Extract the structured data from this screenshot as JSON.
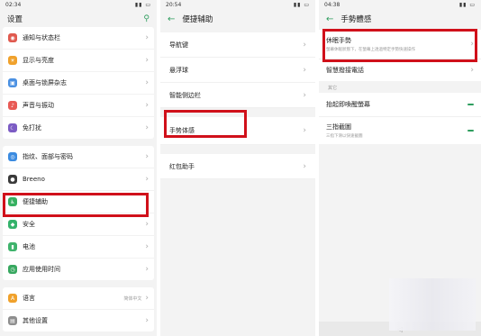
{
  "panel1": {
    "time": "02:34",
    "title": "设置",
    "items": [
      {
        "label": "通知与状态栏",
        "icon": "bell-icon",
        "color": "#e05a4f"
      },
      {
        "label": "显示与亮度",
        "icon": "brightness-icon",
        "color": "#f0a12b"
      },
      {
        "label": "桌面与锁屏杂志",
        "icon": "desktop-icon",
        "color": "#4a90e2"
      },
      {
        "label": "声音与振动",
        "icon": "speaker-icon",
        "color": "#e85a55"
      },
      {
        "label": "免打扰",
        "icon": "moon-icon",
        "color": "#7c5cc4"
      },
      {
        "label": "指纹、面部与密码",
        "icon": "fingerprint-icon",
        "color": "#3b8be0"
      },
      {
        "label": "Breeno",
        "icon": "breeno-icon",
        "color": "#3a3a3a"
      },
      {
        "label": "便捷辅助",
        "icon": "accessibility-icon",
        "color": "#35b060"
      },
      {
        "label": "安全",
        "icon": "shield-icon",
        "color": "#34b26b"
      },
      {
        "label": "电池",
        "icon": "battery-icon",
        "color": "#3fb36c"
      },
      {
        "label": "应用使用时间",
        "icon": "timer-icon",
        "color": "#38a860"
      },
      {
        "label": "语言",
        "icon": "language-icon",
        "color": "#f0a12b",
        "value": "简体中文"
      },
      {
        "label": "其他设置",
        "icon": "more-icon",
        "color": "#8e8e8e"
      }
    ]
  },
  "panel2": {
    "time": "20:54",
    "title": "便捷辅助",
    "items": [
      "导航键",
      "悬浮球",
      "智能侧边栏",
      "手势体感",
      "红包助手"
    ]
  },
  "panel3": {
    "time": "04:38",
    "title": "手勢體感",
    "first_title": "休眠手勢",
    "first_sub": "螢幕休眠狀態下，在螢幕上透過特定手勢快速操作",
    "second_title": "智慧撥接電話",
    "section": "其它",
    "third_title": "抬起即喚醒螢幕",
    "fourth_title": "三指截圖",
    "fourth_sub": "三指下滑以快速截圖"
  }
}
